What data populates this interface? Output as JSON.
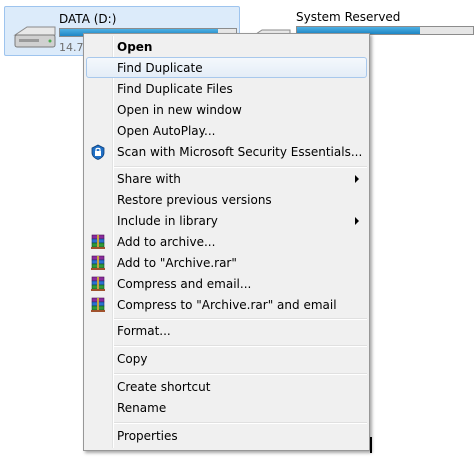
{
  "drives": [
    {
      "name": "DATA (D:)",
      "space_text": "14.7",
      "fill_fraction": 0.9,
      "selected": true
    },
    {
      "name": "System Reserved",
      "fill_fraction": 0.7
    }
  ],
  "menu": {
    "items": [
      {
        "label": "Open",
        "bold": true
      },
      {
        "label": "Find Duplicate",
        "highlighted": true
      },
      {
        "label": "Find Duplicate Files"
      },
      {
        "label": "Open in new window"
      },
      {
        "label": "Open AutoPlay..."
      },
      {
        "label": "Scan with Microsoft Security Essentials...",
        "icon": "security-essentials-icon"
      },
      {
        "label": "Share with",
        "submenu": true
      },
      {
        "label": "Restore previous versions"
      },
      {
        "label": "Include in library",
        "submenu": true
      },
      {
        "label": "Add to archive...",
        "icon": "winrar-icon"
      },
      {
        "label": "Add to \"Archive.rar\"",
        "icon": "winrar-icon"
      },
      {
        "label": "Compress and email...",
        "icon": "winrar-icon"
      },
      {
        "label": "Compress to \"Archive.rar\" and email",
        "icon": "winrar-icon"
      },
      {
        "label": "Format..."
      },
      {
        "label": "Copy"
      },
      {
        "label": "Create shortcut"
      },
      {
        "label": "Rename"
      },
      {
        "label": "Properties"
      }
    ]
  },
  "colors": {
    "menu_background": "#f0f0f0",
    "highlight_border": "#a8c8ec",
    "selected_drive": "#dcebfa",
    "capacity_bar": "#2a95d2"
  }
}
